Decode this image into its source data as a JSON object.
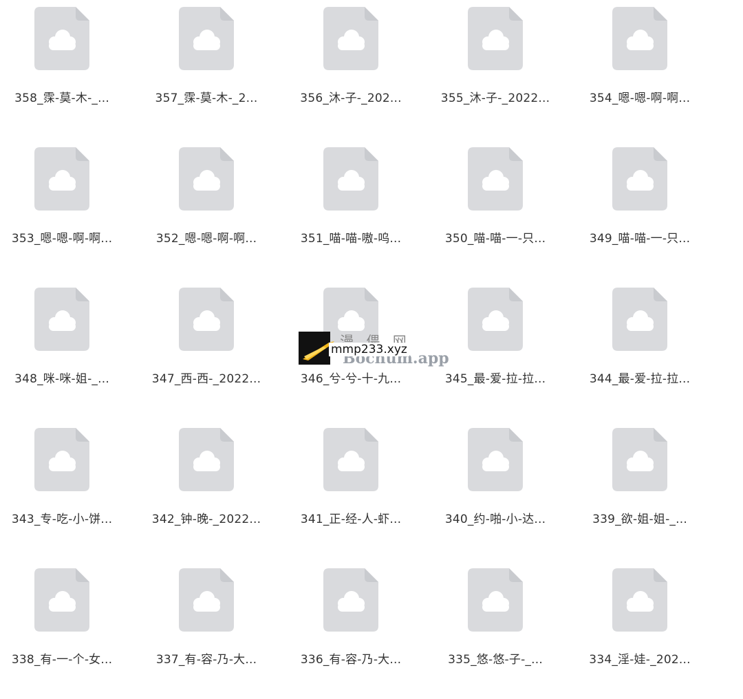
{
  "files": [
    {
      "name": "358_霂-莫-木-_...",
      "icon": "cloud-file-icon"
    },
    {
      "name": "357_霂-莫-木-_2...",
      "icon": "cloud-file-icon"
    },
    {
      "name": "356_沐-子-_202...",
      "icon": "cloud-file-icon"
    },
    {
      "name": "355_沐-子-_2022...",
      "icon": "cloud-file-icon"
    },
    {
      "name": "354_嗯-嗯-啊-啊...",
      "icon": "cloud-file-icon"
    },
    {
      "name": "353_嗯-嗯-啊-啊...",
      "icon": "cloud-file-icon"
    },
    {
      "name": "352_嗯-嗯-啊-啊...",
      "icon": "cloud-file-icon"
    },
    {
      "name": "351_喵-喵-嗷-呜...",
      "icon": "cloud-file-icon"
    },
    {
      "name": "350_喵-喵-一-只...",
      "icon": "cloud-file-icon"
    },
    {
      "name": "349_喵-喵-一-只...",
      "icon": "cloud-file-icon"
    },
    {
      "name": "348_咪-咪-姐-_...",
      "icon": "cloud-file-icon"
    },
    {
      "name": "347_西-西-_2022...",
      "icon": "cloud-file-icon"
    },
    {
      "name": "346_兮-兮-十-九...",
      "icon": "cloud-file-icon"
    },
    {
      "name": "345_最-爱-拉-拉...",
      "icon": "cloud-file-icon"
    },
    {
      "name": "344_最-爱-拉-拉...",
      "icon": "cloud-file-icon"
    },
    {
      "name": "343_专-吃-小-饼...",
      "icon": "cloud-file-icon"
    },
    {
      "name": "342_钟-晚-_2022...",
      "icon": "cloud-file-icon"
    },
    {
      "name": "341_正-经-人-虾...",
      "icon": "cloud-file-icon"
    },
    {
      "name": "340_约-啪-小-达...",
      "icon": "cloud-file-icon"
    },
    {
      "name": "339_欲-姐-姐-_...",
      "icon": "cloud-file-icon"
    },
    {
      "name": "338_有-一-个-女...",
      "icon": "cloud-file-icon"
    },
    {
      "name": "337_有-容-乃-大...",
      "icon": "cloud-file-icon"
    },
    {
      "name": "336_有-容-乃-大...",
      "icon": "cloud-file-icon"
    },
    {
      "name": "335_悠-悠-子-_...",
      "icon": "cloud-file-icon"
    },
    {
      "name": "334_淫-娃-_202...",
      "icon": "cloud-file-icon"
    }
  ],
  "colors": {
    "icon_fill": "#d9dadd",
    "cloud": "#ffffff",
    "label": "#333333"
  },
  "watermark": {
    "logo_icon": "arrow-logo-icon",
    "cn_text": "漫 偎 网",
    "faded_text": "Bochum.app",
    "url": "mmp233.xyz"
  }
}
